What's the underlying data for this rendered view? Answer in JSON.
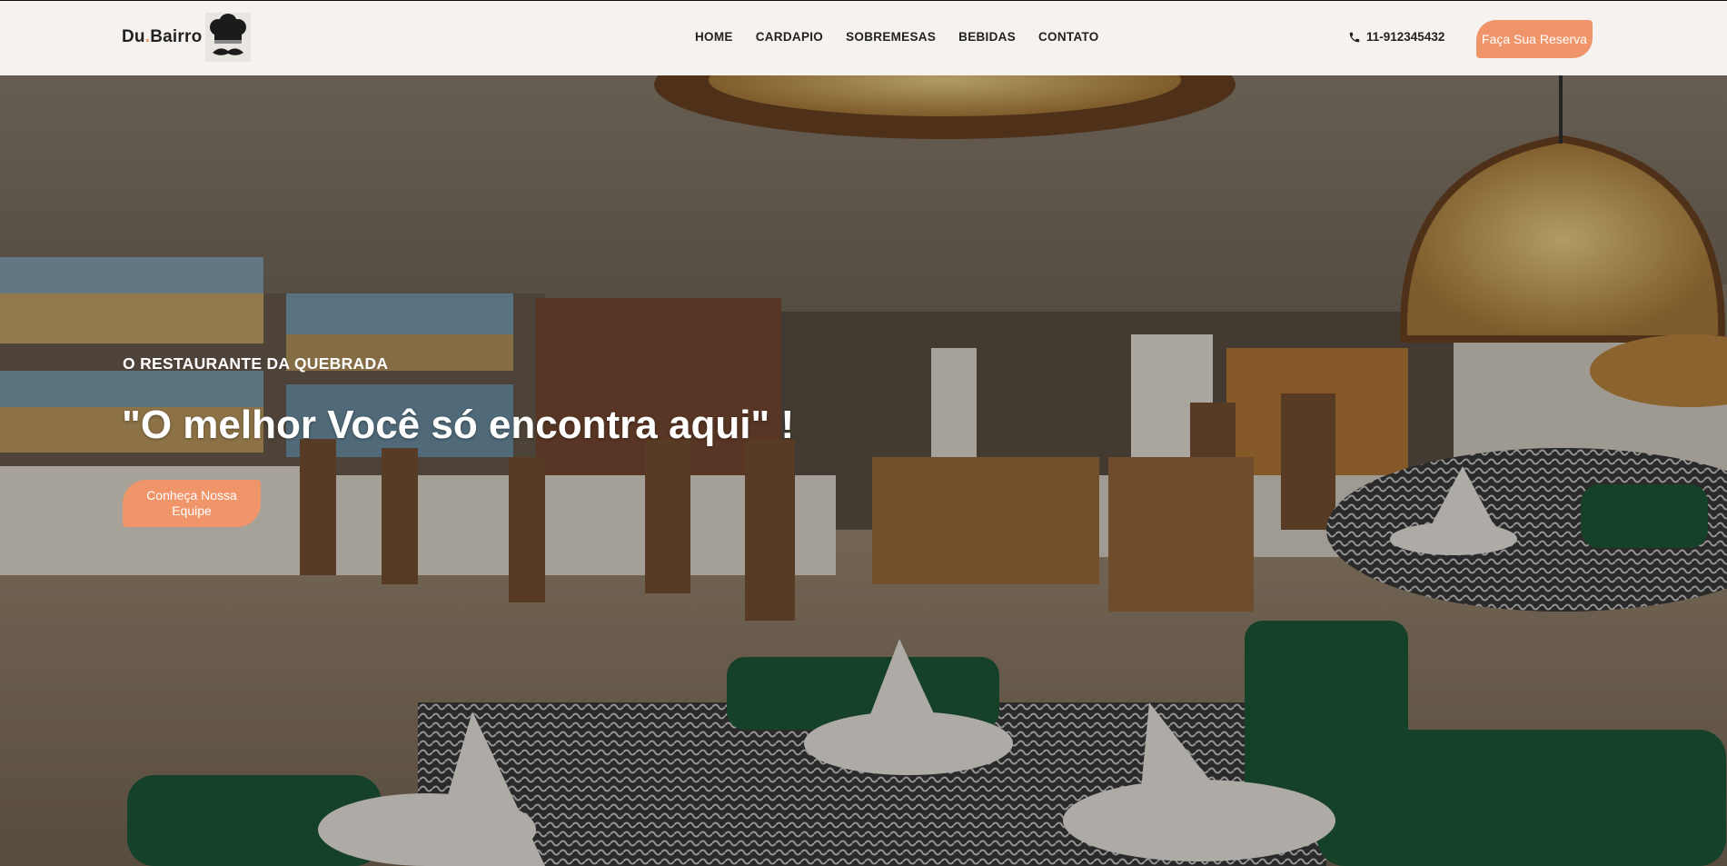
{
  "brand": {
    "name_part1": "Du",
    "name_dot": ".",
    "name_part2": "Bairro",
    "logo_icon": "chef-hat-mustache-icon",
    "accent_color": "#f0956a"
  },
  "nav": {
    "items": [
      {
        "label": "HOME"
      },
      {
        "label": "CARDAPIO"
      },
      {
        "label": "SOBREMESAS"
      },
      {
        "label": "BEBIDAS"
      },
      {
        "label": "CONTATO"
      }
    ]
  },
  "contact": {
    "phone_icon": "phone-icon",
    "phone": "11-912345432"
  },
  "header": {
    "reserve_label": "Faça Sua Reserva"
  },
  "hero": {
    "kicker": "O RESTAURANTE DA QUEBRADA",
    "headline": "\"O melhor Você só encontra aqui\" !",
    "team_button_label": "Conheça Nossa Equipe",
    "background": "restaurant-dining-room-image"
  }
}
